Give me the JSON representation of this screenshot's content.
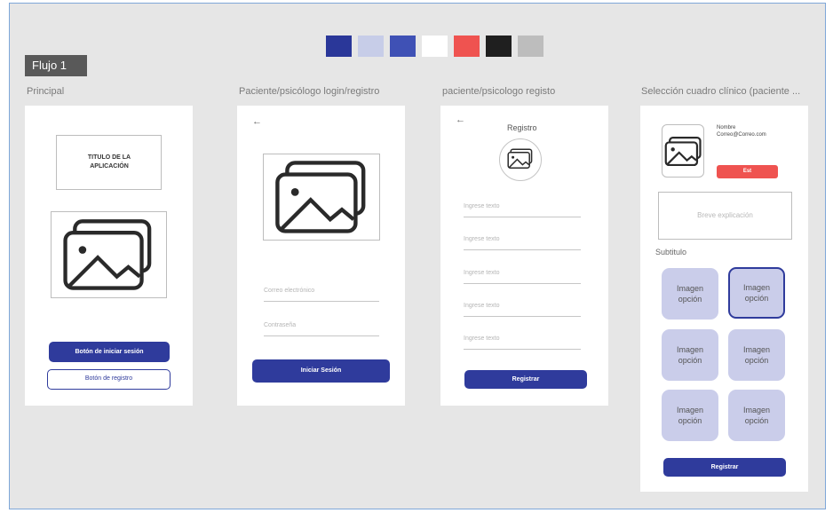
{
  "palette": [
    "#2a3799",
    "#c7cde8",
    "#3f51b5",
    "#ffffff",
    "#ef5350",
    "#1f1f1f",
    "#bdbdbd"
  ],
  "flow_label": "Flujo 1",
  "frames": [
    {
      "title": "Principal",
      "app_title": "TITULO DE LA APLICACIÓN",
      "primary_button": "Botón de iniciar sesión",
      "secondary_button": "Botón de registro"
    },
    {
      "title": "Paciente/psicólogo login/registro",
      "back_icon": "←",
      "email_placeholder": "Correo electrónico",
      "password_placeholder": "Contraseña",
      "login_button": "Iniciar Sesión"
    },
    {
      "title": "paciente/psicologo registo",
      "back_icon": "←",
      "heading": "Registro",
      "fields": [
        "Ingrese texto",
        "Ingrese texto",
        "Ingrese texto",
        "Ingrese texto",
        "Ingrese texto"
      ],
      "register_button": "Registrar"
    },
    {
      "title": "Selección cuadro clínico (paciente ...",
      "profile_name": "Nombre",
      "profile_email": "Correo@Correo.com",
      "badge": "Est",
      "explanation_placeholder": "Breve explicación",
      "subtitle": "Subtitulo",
      "options": [
        "Imagen opción",
        "Imagen opción",
        "Imagen opción",
        "Imagen opción",
        "Imagen opción",
        "Imagen opción"
      ],
      "register_button": "Registrar"
    }
  ]
}
